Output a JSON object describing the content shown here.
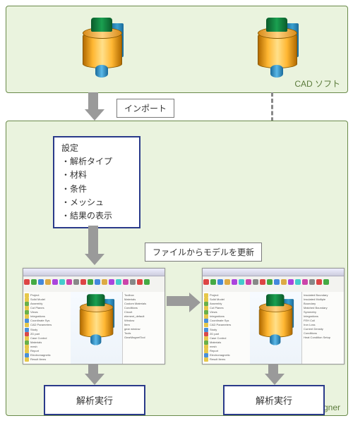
{
  "cad": {
    "title": "CAD ソフト"
  },
  "jmag": {
    "title": "JMAG-Designer"
  },
  "labels": {
    "import": "インポート",
    "update_from_file": "ファイルからモデルを更新"
  },
  "settings": {
    "heading": "設定",
    "items": [
      "・解析タイプ",
      "・材料",
      "・条件",
      "・メッシュ",
      "・結果の表示"
    ]
  },
  "run": {
    "left": "解析実行",
    "right": "解析実行"
  },
  "tb_colors": [
    "#d44",
    "#4a4",
    "#48d",
    "#da4",
    "#a4d",
    "#4cc",
    "#c4a",
    "#888",
    "#d44",
    "#4a4",
    "#48d",
    "#da4",
    "#a4d",
    "#4cc",
    "#c4a",
    "#888",
    "#d44",
    "#4a4"
  ],
  "tree_rows": [
    {
      "c": "#e6c84a",
      "t": "Project"
    },
    {
      "c": "#e6c84a",
      "t": "Solid Model"
    },
    {
      "c": "#6ab04a",
      "t": "Assembly"
    },
    {
      "c": "#e6c84a",
      "t": "Cut Planes"
    },
    {
      "c": "#6ab04a",
      "t": "Views"
    },
    {
      "c": "#e6c84a",
      "t": "Integrations"
    },
    {
      "c": "#4a90d9",
      "t": "Coordinate Sys"
    },
    {
      "c": "#e6c84a",
      "t": "CAD Parameters"
    },
    {
      "c": "#4a90d9",
      "t": "Study"
    },
    {
      "c": "#d94a4a",
      "t": "2D part"
    },
    {
      "c": "#e6c84a",
      "t": "Case Control"
    },
    {
      "c": "#6ab04a",
      "t": "Materials"
    },
    {
      "c": "#e6c84a",
      "t": "mesh"
    },
    {
      "c": "#e6c84a",
      "t": "Report"
    },
    {
      "c": "#4a90d9",
      "t": "Electromagnetic"
    },
    {
      "c": "#e6c84a",
      "t": "Result Items"
    }
  ],
  "side_rows_a": [
    {
      "c": "#e6c84a",
      "t": "Toolbox"
    },
    {
      "c": "#6ab04a",
      "t": "Materials"
    },
    {
      "c": "#4a90d9",
      "t": "Custom Materials"
    },
    {
      "c": "#e6c84a",
      "t": "Conditions"
    },
    {
      "c": "#6ab04a",
      "t": "Circuit"
    },
    {
      "c": "#e6c84a",
      "t": "element_default"
    },
    {
      "c": "#4a90d9",
      "t": "Window"
    },
    {
      "c": "#d94a4a",
      "t": "Item"
    },
    {
      "c": "#e6c84a",
      "t": "gear window"
    },
    {
      "c": "#e6c84a",
      "t": "Tools"
    },
    {
      "c": "#6ab04a",
      "t": "GearMagnetTool"
    }
  ],
  "side_rows_b": [
    {
      "c": "#4a90d9",
      "t": "Insulated Boundary"
    },
    {
      "c": "#4a90d9",
      "t": "Insulated Multiple"
    },
    {
      "c": "#e6c84a",
      "t": "Boundary"
    },
    {
      "c": "#4a90d9",
      "t": "Matched Boundary"
    },
    {
      "c": "#6ab04a",
      "t": "Symmetry"
    },
    {
      "c": "#e6c84a",
      "t": "Integrations"
    },
    {
      "c": "#d94a4a",
      "t": "FEH Coil"
    },
    {
      "c": "#e6c84a",
      "t": "Iron Loss"
    },
    {
      "c": "#d94a4a",
      "t": "Current Density"
    },
    {
      "c": "#e6c84a",
      "t": "Conditions"
    },
    {
      "c": "#6ab04a",
      "t": "Heat Condition Setup"
    }
  ]
}
